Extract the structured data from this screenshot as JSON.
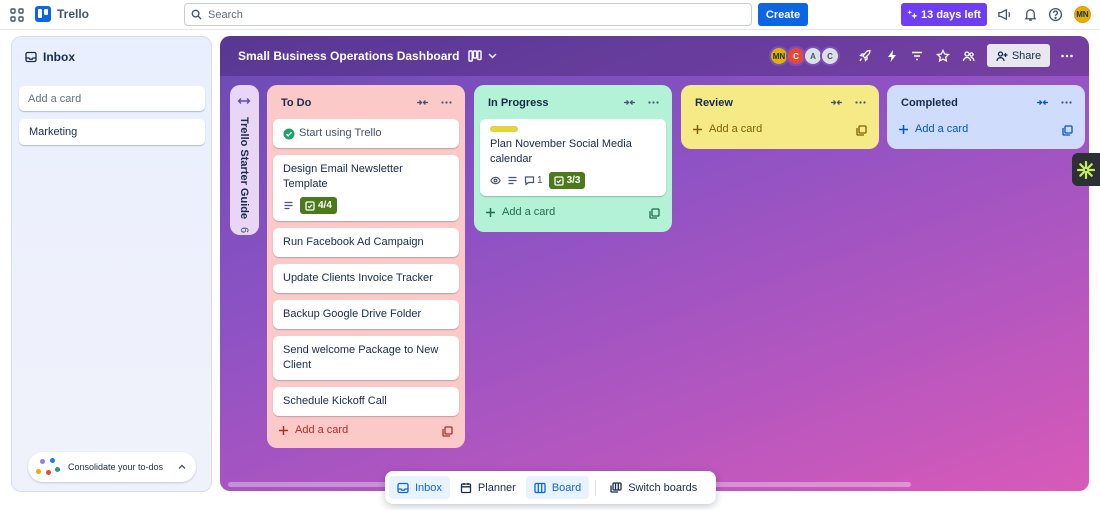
{
  "app": {
    "name": "Trello"
  },
  "topbar": {
    "search_placeholder": "Search",
    "create_label": "Create",
    "trial_label": "13 days left",
    "user_initials": "MN"
  },
  "inbox": {
    "title": "Inbox",
    "add_placeholder": "Add a card",
    "cards": [
      {
        "title": "Marketing"
      }
    ],
    "consolidate_label": "Consolidate your to-dos"
  },
  "board": {
    "title": "Small Business Operations Dashboard",
    "members": [
      {
        "initials": "MN",
        "color": "#e2b203"
      },
      {
        "initials": "C",
        "color": "#e34935"
      },
      {
        "initials": "A",
        "color": "#dcdfe4"
      },
      {
        "initials": "C",
        "color": "#dcdfe4"
      }
    ],
    "share_label": "Share",
    "starter_guide": {
      "title": "Trello Starter Guide",
      "count": "6"
    },
    "lists": [
      {
        "title": "To Do",
        "color": "#fcc9c9",
        "add_label": "Add a card",
        "cards": [
          {
            "title": "Start using Trello",
            "done": true
          },
          {
            "title": "Design Email Newsletter Template",
            "has_description": true,
            "checklist": "4/4"
          },
          {
            "title": "Run Facebook Ad Campaign"
          },
          {
            "title": "Update Clients Invoice Tracker"
          },
          {
            "title": "Backup Google Drive Folder"
          },
          {
            "title": "Send welcome Package to New Client"
          },
          {
            "title": "Schedule Kickoff Call"
          }
        ]
      },
      {
        "title": "In Progress",
        "color": "#b3f2d6",
        "add_label": "Add a card",
        "cards": [
          {
            "title": "Plan November Social Media calendar",
            "label_color": "#e2d53a",
            "watching": true,
            "has_description": true,
            "comments": "1",
            "checklist": "3/3"
          }
        ]
      },
      {
        "title": "Review",
        "color": "#f5ea86",
        "add_label": "Add a card",
        "cards": []
      },
      {
        "title": "Completed",
        "color": "#cfdcfc",
        "add_label": "Add a card",
        "cards": []
      }
    ]
  },
  "bottom_nav": {
    "items": [
      {
        "label": "Inbox",
        "icon": "inbox-icon",
        "active": true
      },
      {
        "label": "Planner",
        "icon": "calendar-icon",
        "active": false
      },
      {
        "label": "Board",
        "icon": "board-icon",
        "active": true
      },
      {
        "label": "Switch boards",
        "icon": "switch-boards-icon",
        "active": false
      }
    ]
  },
  "colors": {
    "accent": "#0c66e4",
    "trial": "#6e3ef2",
    "checklist_done": "#4c7a1a"
  }
}
